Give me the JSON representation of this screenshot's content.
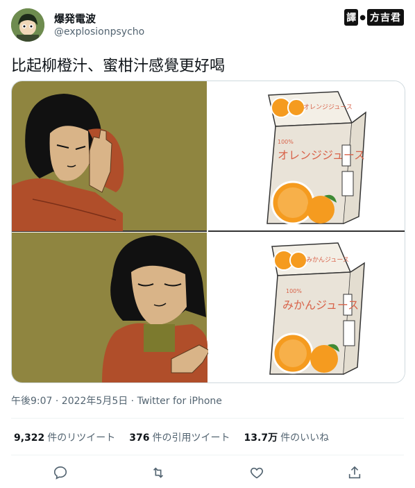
{
  "author": {
    "name": "爆発電波",
    "handle": "@explosionpsycho"
  },
  "badge": {
    "left": "譯",
    "sep": "●",
    "right": "方吉君"
  },
  "tweet": {
    "text": "比起柳橙汁、蜜柑汁感覺更好喝"
  },
  "media": {
    "top_carton": {
      "title": "オレンジジュース",
      "percent": "100%",
      "small": "オレンジジュース"
    },
    "bottom_carton": {
      "title": "みかんジュース",
      "percent": "100%",
      "small": "みかんジュース"
    }
  },
  "meta": {
    "time": "午後9:07 · 2022年5月5日",
    "source": "Twitter for iPhone"
  },
  "stats": {
    "retweets": {
      "count": "9,322",
      "label": "件のリツイート"
    },
    "quotes": {
      "count": "376",
      "label": "件の引用ツイート"
    },
    "likes": {
      "count": "13.7万",
      "label": "件のいいね"
    }
  },
  "icons": [
    "reply-icon",
    "retweet-icon",
    "like-icon",
    "share-icon"
  ],
  "colors": {
    "olive": "#8f8540",
    "jacket": "#b04e2a",
    "orange": "#f59b1f",
    "carton": "#e9e3d8",
    "text_red": "#d8634a"
  }
}
